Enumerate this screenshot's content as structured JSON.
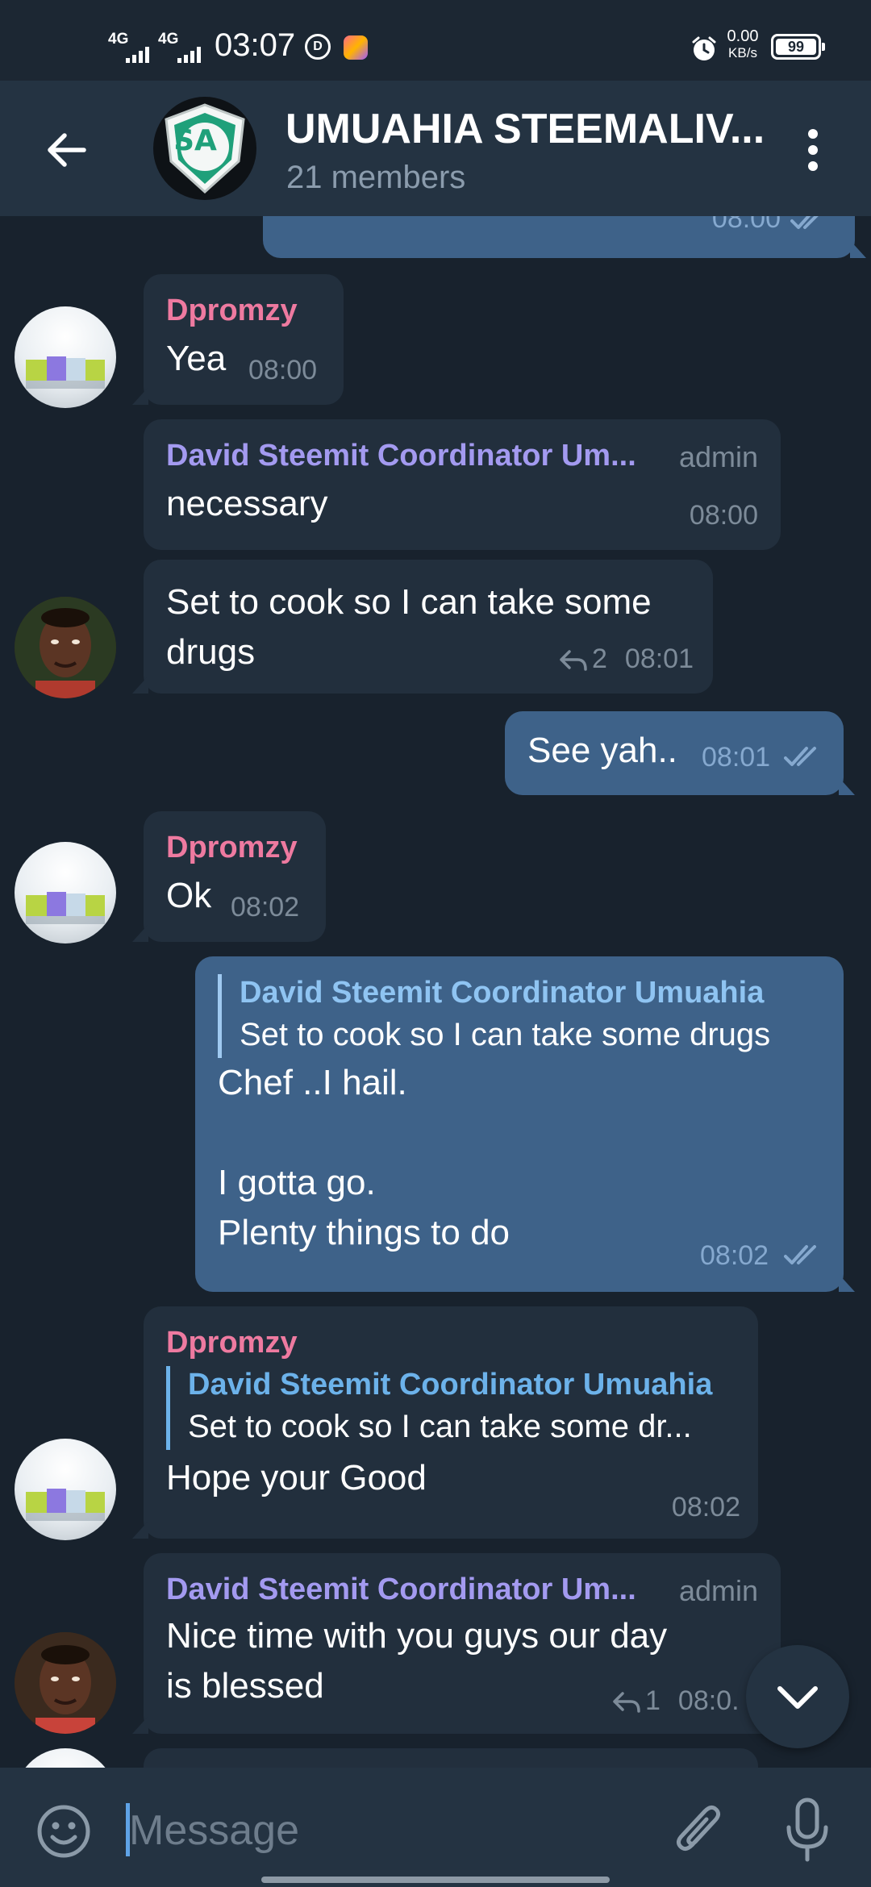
{
  "status_bar": {
    "network_1": "4G",
    "network_2": "4G",
    "time": "03:07",
    "speed_value": "0.00",
    "speed_unit": "KB/s",
    "battery": "99"
  },
  "header": {
    "title": "UMUAHIA STEEMALIV...",
    "subtitle": "21 members",
    "avatar_letters": "SA"
  },
  "messages": [
    {
      "id": "m0",
      "time": "08:00"
    },
    {
      "id": "m1",
      "sender": "Dpromzy",
      "text": "Yea",
      "time": "08:00"
    },
    {
      "id": "m2",
      "sender": "David Steemit Coordinator Um...",
      "role": "admin",
      "text": "necessary",
      "time": "08:00"
    },
    {
      "id": "m3",
      "lines": [
        "Set to cook so I can take some",
        "drugs"
      ],
      "replies": "2",
      "time": "08:01"
    },
    {
      "id": "m4",
      "text": "See yah..",
      "time": "08:01"
    },
    {
      "id": "m5",
      "sender": "Dpromzy",
      "text": "Ok",
      "time": "08:02"
    },
    {
      "id": "m6",
      "quote_name": "David Steemit Coordinator Umuahia",
      "quote_text": "Set to cook so I can take some drugs",
      "lines": [
        "Chef ..I hail.",
        "",
        "I gotta go.",
        "Plenty things to do"
      ],
      "time": "08:02"
    },
    {
      "id": "m7",
      "sender": "Dpromzy",
      "quote_name": "David Steemit Coordinator Umuahia",
      "quote_text": "Set to cook so I can take some dr...",
      "text": "Hope your Good",
      "time": "08:02"
    },
    {
      "id": "m8",
      "sender": "David Steemit Coordinator Um...",
      "role": "admin",
      "lines": [
        "Nice time with you guys our day",
        "is blessed"
      ],
      "replies": "1",
      "time": "08:0."
    }
  ],
  "input": {
    "placeholder": "Message"
  },
  "colors": {
    "background": "#18222d",
    "header": "#243342",
    "bubble_in": "#222f3d",
    "bubble_out": "#3e6289",
    "sender_pink": "#ee7aa0",
    "sender_violet": "#a39af0",
    "quote_blue": "#6cb2ea",
    "accent": "#5fa3e6"
  },
  "icons": {
    "back": "arrow-left-icon",
    "more": "more-vertical-icon",
    "read": "double-check-icon",
    "reply": "reply-arrow-icon",
    "scroll": "chevron-down-icon",
    "emoji": "emoji-icon",
    "attach": "paperclip-icon",
    "mic": "microphone-icon"
  }
}
